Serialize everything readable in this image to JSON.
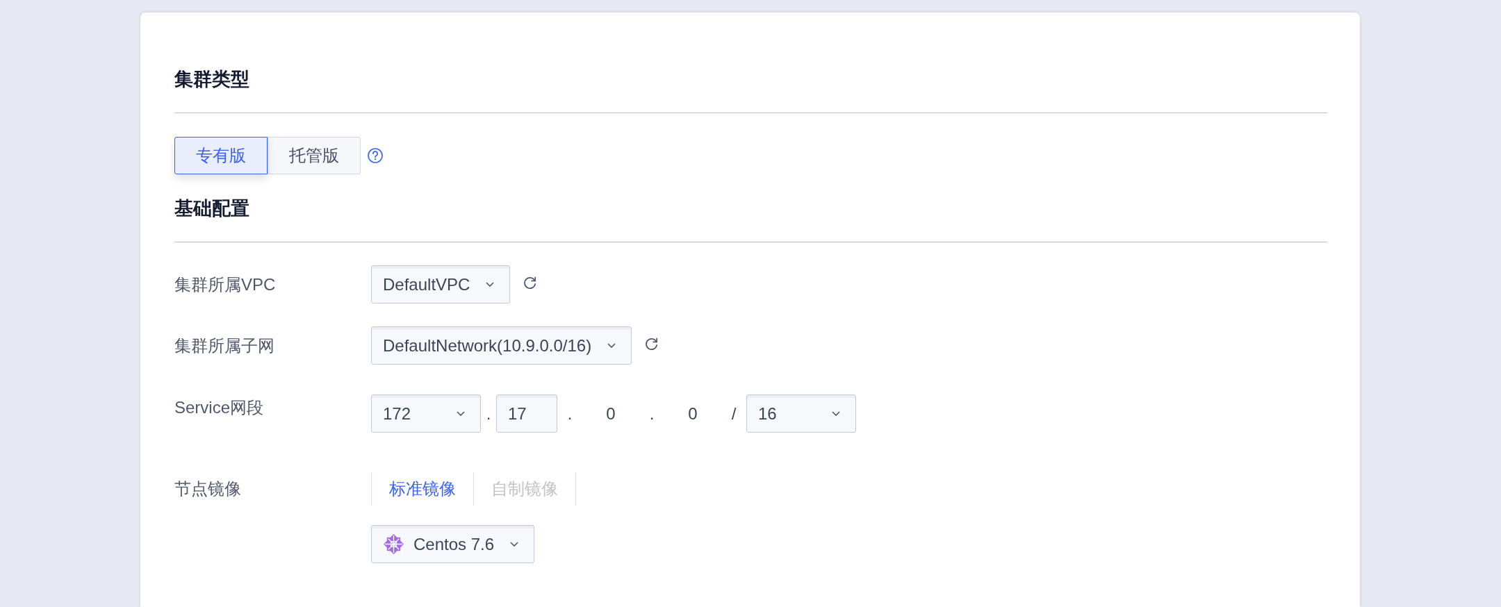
{
  "cluster_type": {
    "title": "集群类型",
    "options": [
      {
        "label": "专有版",
        "selected": true
      },
      {
        "label": "托管版",
        "selected": false
      }
    ],
    "help": true
  },
  "basic_config": {
    "title": "基础配置",
    "fields": [
      {
        "kind": "select",
        "label": "集群所属VPC",
        "value": "DefaultVPC",
        "refresh": true
      },
      {
        "kind": "select",
        "label": "集群所属子网",
        "value": "DefaultNetwork(10.9.0.0/16)",
        "refresh": true
      },
      {
        "kind": "cidr",
        "label": "Service网段",
        "parts": [
          {
            "kind": "select",
            "value": "172"
          },
          {
            "kind": "separator",
            "value": "."
          },
          {
            "kind": "input",
            "value": "17"
          },
          {
            "kind": "separator",
            "value": "."
          },
          {
            "kind": "text",
            "value": "0"
          },
          {
            "kind": "separator",
            "value": "."
          },
          {
            "kind": "text",
            "value": "0"
          },
          {
            "kind": "separator",
            "value": "/"
          },
          {
            "kind": "select",
            "value": "16"
          }
        ]
      },
      {
        "kind": "image",
        "label": "节点镜像",
        "tabs": [
          {
            "label": "标准镜像",
            "selected": true
          },
          {
            "label": "自制镜像",
            "selected": false
          }
        ],
        "os": {
          "value": "Centos 7.6"
        }
      }
    ]
  }
}
